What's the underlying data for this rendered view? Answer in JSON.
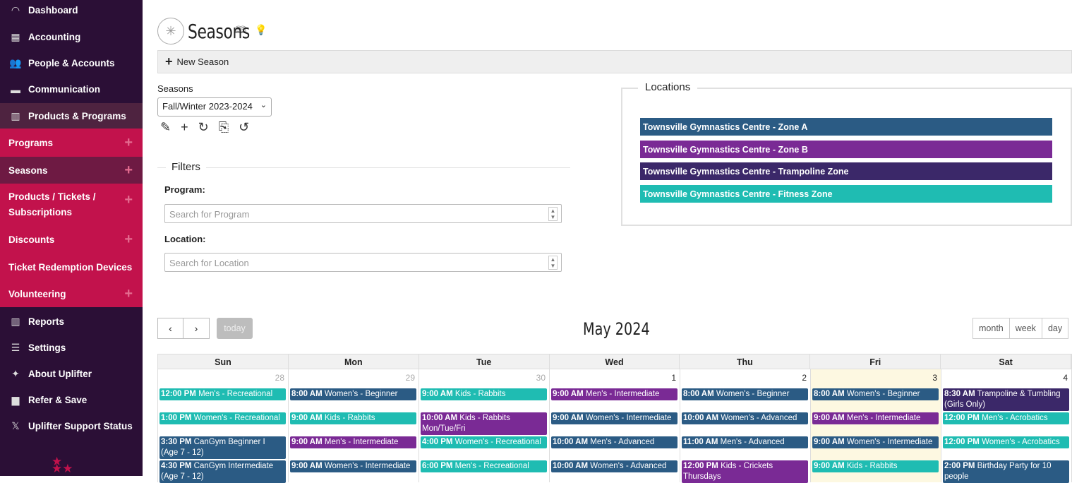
{
  "colors": {
    "zone_a": "#2b5b84",
    "zone_b": "#7a2a95",
    "trampoline": "#3b2869",
    "fitness": "#1fbcb2",
    "sidebar": "#2b0f36",
    "sub": "#c2124c"
  },
  "sidebar": {
    "items": [
      {
        "label": "Dashboard",
        "icon": "gauge-icon",
        "glyph": "◠"
      },
      {
        "label": "Accounting",
        "icon": "calculator-icon",
        "glyph": "▦"
      },
      {
        "label": "People & Accounts",
        "icon": "people-icon",
        "glyph": "👥"
      },
      {
        "label": "Communication",
        "icon": "chat-icon",
        "glyph": "▬"
      },
      {
        "label": "Products & Programs",
        "icon": "barcode-icon",
        "glyph": "▥"
      }
    ],
    "subitems": [
      {
        "label": "Programs"
      },
      {
        "label": "Seasons"
      },
      {
        "label": "Products / Tickets /",
        "label2": "Subscriptions"
      },
      {
        "label": "Discounts"
      },
      {
        "label": "Ticket Redemption Devices"
      },
      {
        "label": "Volunteering"
      }
    ],
    "bottom": [
      {
        "label": "Reports",
        "icon": "bar-chart-icon",
        "glyph": "▥"
      },
      {
        "label": "Settings",
        "icon": "sliders-icon",
        "glyph": "☰"
      },
      {
        "label": "About Uplifter",
        "icon": "sparkle-icon",
        "glyph": "✦"
      },
      {
        "label": "Refer & Save",
        "icon": "gift-card-icon",
        "glyph": "▆"
      },
      {
        "label": "Uplifter Support Status",
        "icon": "x-logo-icon",
        "glyph": "𝕏"
      }
    ]
  },
  "header": {
    "title": "Seasons",
    "new_season": "New Season"
  },
  "seasons": {
    "label": "Seasons",
    "selected": "Fall/Winter 2023-2024"
  },
  "filters": {
    "legend": "Filters",
    "program_label": "Program:",
    "program_placeholder": "Search for Program",
    "location_label": "Location:",
    "location_placeholder": "Search for Location"
  },
  "locations": {
    "legend": "Locations",
    "items": [
      {
        "name": "Townsville Gymnastics Centre - Zone A",
        "color": "#2b5b84"
      },
      {
        "name": "Townsville Gymnastics Centre - Zone B",
        "color": "#7a2a95"
      },
      {
        "name": "Townsville Gymnastics Centre - Trampoline Zone",
        "color": "#3b2869"
      },
      {
        "name": "Townsville Gymnastics Centre - Fitness Zone",
        "color": "#1fbcb2"
      }
    ]
  },
  "calendar": {
    "title": "May 2024",
    "today_label": "today",
    "views": [
      "month",
      "week",
      "day"
    ],
    "days": [
      "Sun",
      "Mon",
      "Tue",
      "Wed",
      "Thu",
      "Fri",
      "Sat"
    ],
    "dates": [
      {
        "num": "28",
        "other": true
      },
      {
        "num": "29",
        "other": true
      },
      {
        "num": "30",
        "other": true
      },
      {
        "num": "1",
        "other": false
      },
      {
        "num": "2",
        "other": false
      },
      {
        "num": "3",
        "other": false,
        "today": true
      },
      {
        "num": "4",
        "other": false
      }
    ],
    "events": [
      [
        {
          "time": "12:00 PM",
          "title": "Men's - Recreational",
          "color": "#1fbcb2"
        },
        {
          "time": "1:00 PM",
          "title": "Women's - Recreational",
          "color": "#1fbcb2"
        },
        {
          "time": "3:30 PM",
          "title": "CanGym Beginner I (Age 7 - 12)",
          "color": "#2b5b84"
        },
        {
          "time": "4:30 PM",
          "title": "CanGym Intermediate (Age 7 - 12)",
          "color": "#2b5b84"
        }
      ],
      [
        {
          "time": "8:00 AM",
          "title": "Women's - Beginner",
          "color": "#2b5b84"
        },
        {
          "time": "9:00 AM",
          "title": "Kids - Rabbits",
          "color": "#1fbcb2"
        },
        {
          "time": "9:00 AM",
          "title": "Men's - Intermediate",
          "color": "#7a2a95"
        },
        {
          "time": "9:00 AM",
          "title": "Women's - Intermediate",
          "color": "#2b5b84"
        }
      ],
      [
        {
          "time": "9:00 AM",
          "title": "Kids - Rabbits",
          "color": "#1fbcb2"
        },
        {
          "time": "10:00 AM",
          "title": "Kids - Rabbits Mon/Tue/Fri",
          "color": "#7a2a95"
        },
        {
          "time": "4:00 PM",
          "title": "Women's - Recreational",
          "color": "#1fbcb2"
        },
        {
          "time": "6:00 PM",
          "title": "Men's - Recreational",
          "color": "#1fbcb2"
        }
      ],
      [
        {
          "time": "9:00 AM",
          "title": "Men's - Intermediate",
          "color": "#7a2a95"
        },
        {
          "time": "9:00 AM",
          "title": "Women's - Intermediate",
          "color": "#2b5b84"
        },
        {
          "time": "10:00 AM",
          "title": "Men's - Advanced",
          "color": "#2b5b84"
        },
        {
          "time": "10:00 AM",
          "title": "Women's - Advanced",
          "color": "#2b5b84"
        }
      ],
      [
        {
          "time": "8:00 AM",
          "title": "Women's - Beginner",
          "color": "#2b5b84"
        },
        {
          "time": "10:00 AM",
          "title": "Women's - Advanced",
          "color": "#2b5b84"
        },
        {
          "time": "11:00 AM",
          "title": "Men's - Advanced",
          "color": "#2b5b84"
        },
        {
          "time": "12:00 PM",
          "title": "Kids - Crickets Thursdays",
          "color": "#7a2a95"
        }
      ],
      [
        {
          "time": "8:00 AM",
          "title": "Women's - Beginner",
          "color": "#2b5b84"
        },
        {
          "time": "9:00 AM",
          "title": "Men's - Intermediate",
          "color": "#7a2a95"
        },
        {
          "time": "9:00 AM",
          "title": "Women's - Intermediate",
          "color": "#2b5b84"
        },
        {
          "time": "9:00 AM",
          "title": "Kids - Rabbits",
          "color": "#1fbcb2"
        }
      ],
      [
        {
          "time": "8:30 AM",
          "title": "Trampoline & Tumbling (Girls Only)",
          "color": "#3b2869"
        },
        {
          "time": "12:00 PM",
          "title": "Men's - Acrobatics",
          "color": "#1fbcb2"
        },
        {
          "time": "12:00 PM",
          "title": "Women's - Acrobatics",
          "color": "#1fbcb2"
        },
        {
          "time": "2:00 PM",
          "title": "Birthday Party for 10 people",
          "color": "#2b5b84"
        }
      ]
    ]
  }
}
